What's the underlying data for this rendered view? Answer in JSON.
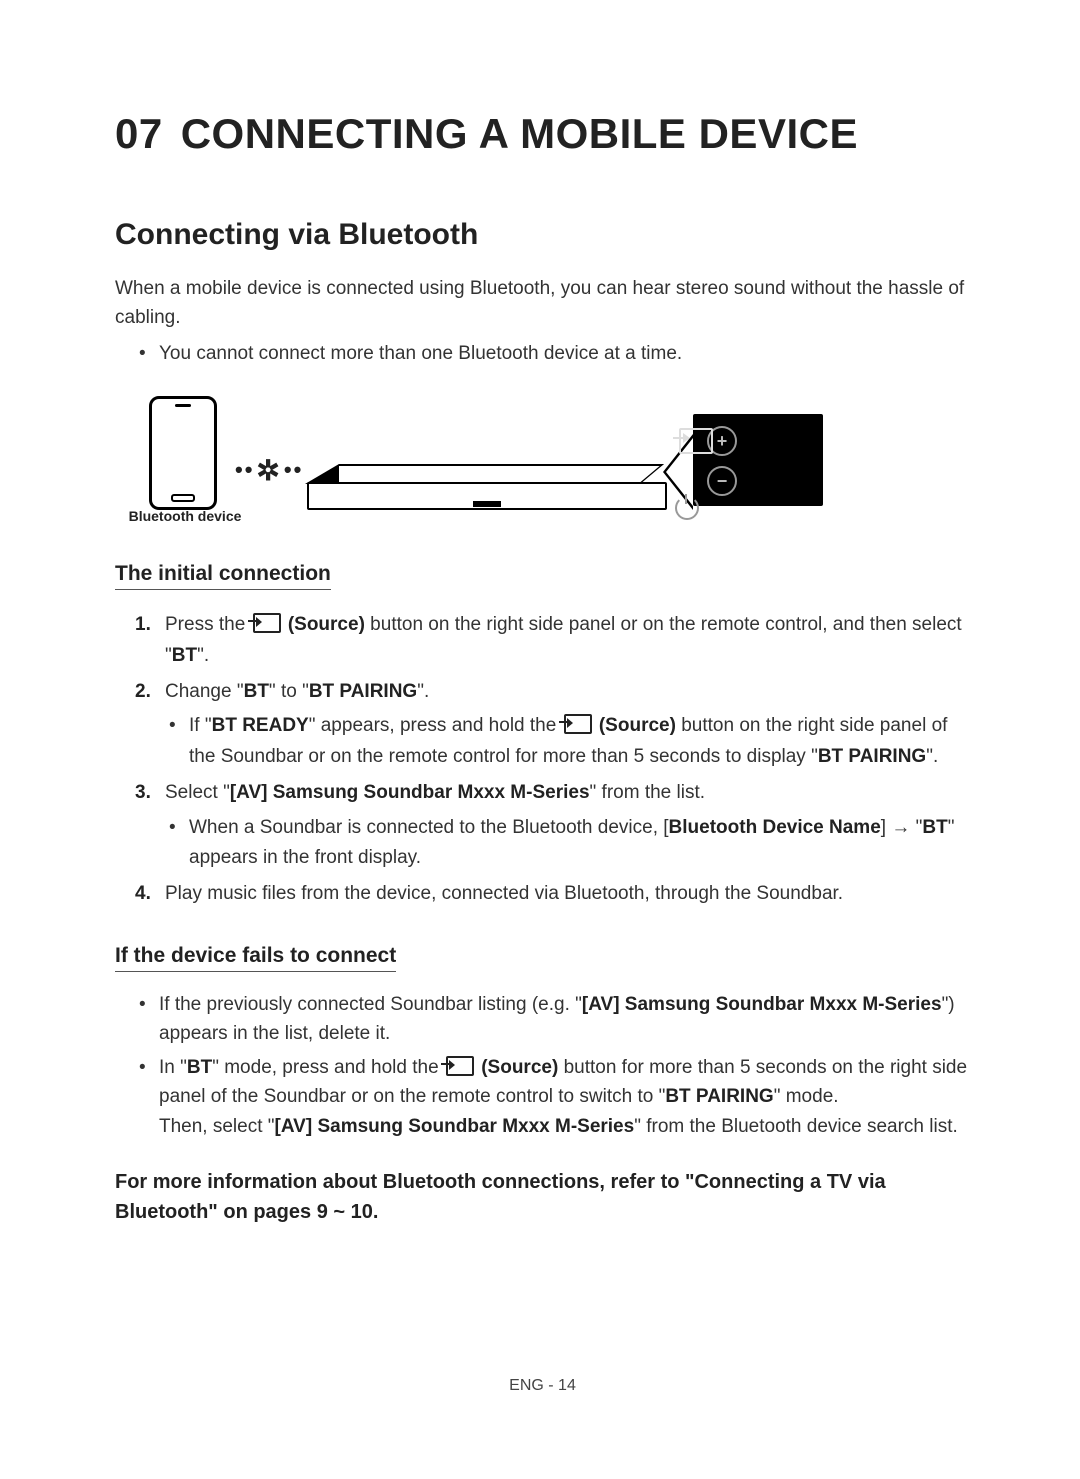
{
  "chapter": {
    "number": "07",
    "title": "CONNECTING A MOBILE DEVICE"
  },
  "section_title": "Connecting via Bluetooth",
  "intro": "When a mobile device is connected using Bluetooth, you can hear stereo sound without the hassle of cabling.",
  "intro_bullet": "You cannot connect more than one Bluetooth device at a time.",
  "diagram": {
    "device_label": "Bluetooth device",
    "panel_plus": "+",
    "panel_minus": "−"
  },
  "initial": {
    "heading": "The initial connection",
    "step1": {
      "pre": "Press the ",
      "source_bold": "(Source)",
      "post1": " button on the right side panel or on the remote control, and then select \"",
      "bt": "BT",
      "post2": "\"."
    },
    "step2": {
      "pre": "Change \"",
      "bt": "BT",
      "mid": "\" to \"",
      "btpair": "BT PAIRING",
      "post": "\".",
      "sub": {
        "pre": "If \"",
        "btready": "BT READY",
        "mid1": "\" appears, press and hold the ",
        "source_bold": "(Source)",
        "mid2": " button on the right side panel of the Soundbar or on the remote control for more than 5 seconds to display \"",
        "btpair": "BT PAIRING",
        "post": "\"."
      }
    },
    "step3": {
      "pre": "Select \"",
      "av": "[AV] Samsung Soundbar Mxxx M-Series",
      "post": "\" from the list.",
      "sub": {
        "pre": "When a Soundbar is connected to the Bluetooth device, [",
        "bdn": "Bluetooth Device Name",
        "mid": "] → \"",
        "bt": "BT",
        "post": "\" appears in the front display."
      }
    },
    "step4": "Play music files from the device, connected via Bluetooth, through the Soundbar."
  },
  "fails": {
    "heading": "If the device fails to connect",
    "b1": {
      "pre": "If the previously connected Soundbar listing (e.g. \"",
      "av": "[AV] Samsung Soundbar Mxxx M-Series",
      "post": "\") appears in the list, delete it."
    },
    "b2": {
      "pre": "In \"",
      "bt": "BT",
      "mid1": "\" mode, press and hold the ",
      "source_bold": "(Source)",
      "mid2": " button for more than 5 seconds on the right side panel of the Soundbar or on the remote control to switch to \"",
      "btpair": "BT PAIRING",
      "mid3": "\" mode.",
      "line2_pre": "Then, select \"",
      "av": "[AV] Samsung Soundbar Mxxx M-Series",
      "line2_post": "\" from the Bluetooth device search list."
    }
  },
  "moreinfo": "For more information about Bluetooth connections, refer to \"Connecting a TV via Bluetooth\" on pages 9 ~ 10.",
  "footer": "ENG - 14"
}
